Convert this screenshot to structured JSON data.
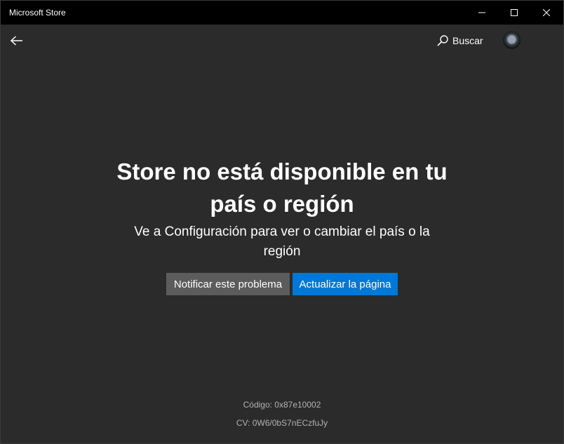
{
  "window": {
    "title": "Microsoft Store"
  },
  "nav": {
    "search_label": "Buscar"
  },
  "message": {
    "headline_line1": "Store no está disponible en tu",
    "headline_line2": "país o región",
    "subtext_line1": "Ve a Configuración para ver o cambiar el país o la",
    "subtext_line2": "región"
  },
  "actions": {
    "report_label": "Notificar este problema",
    "refresh_label": "Actualizar la página"
  },
  "footer": {
    "code": "Código: 0x87e10002",
    "cv": "CV: 0W6/0bS7nECzfuJy"
  },
  "colors": {
    "background": "#2b2b2b",
    "titlebar": "#000000",
    "accent": "#0078d7",
    "secondary_button": "#5c5c5c"
  },
  "icons": {
    "back": "back-arrow-icon",
    "search": "search-icon",
    "minimize": "minimize-icon",
    "maximize": "maximize-icon",
    "close": "close-icon"
  }
}
